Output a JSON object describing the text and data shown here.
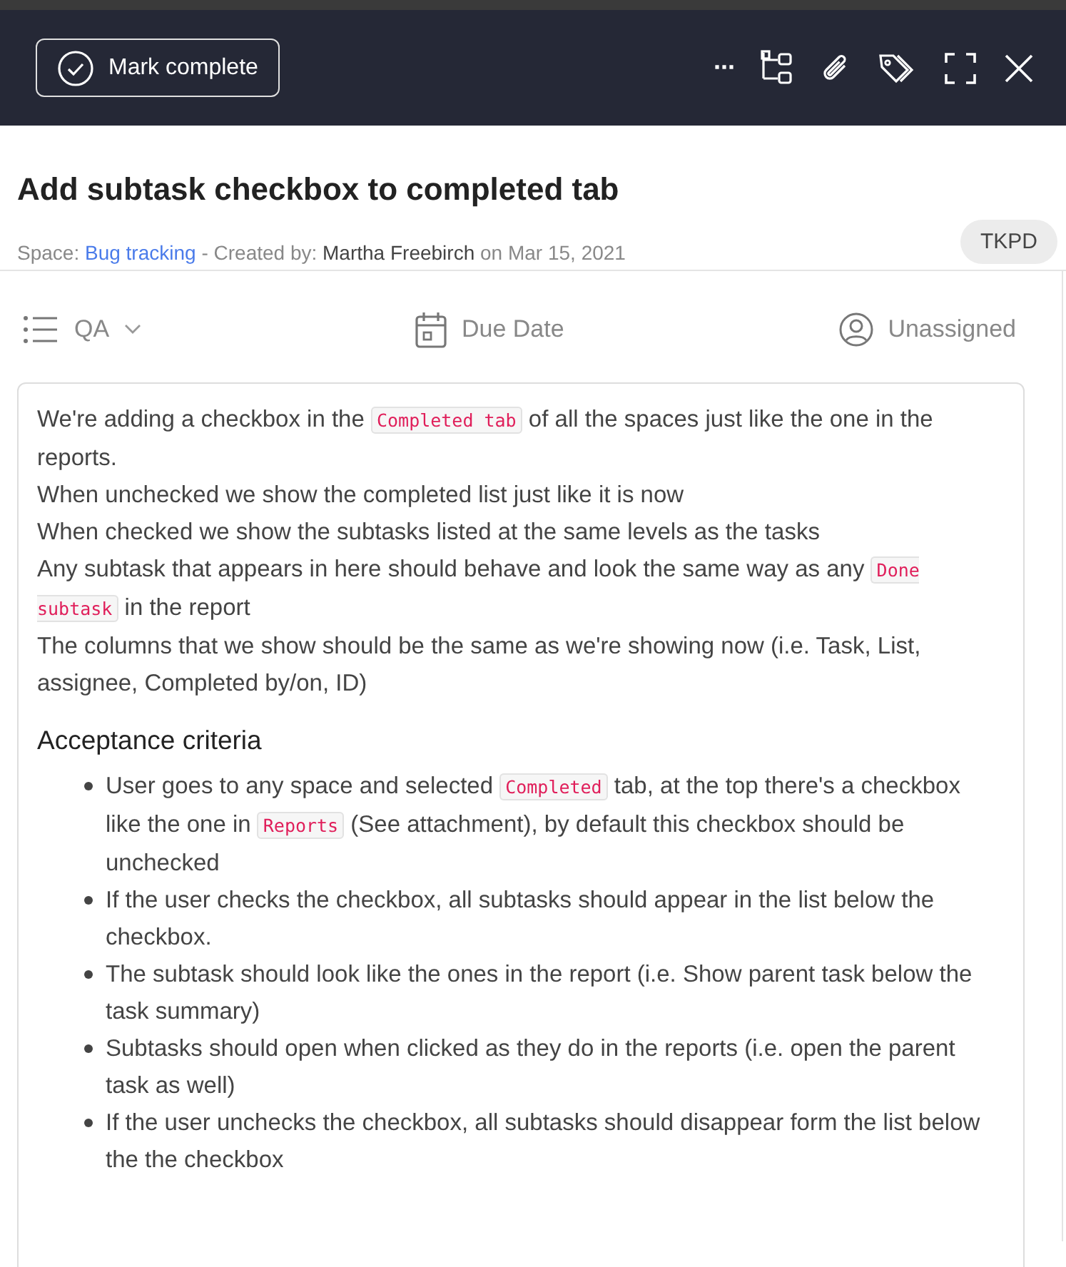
{
  "header": {
    "mark_complete": "Mark complete",
    "more": "···"
  },
  "title": "Add subtask checkbox to completed tab",
  "meta": [
    {
      "kind": "text",
      "text": "Space: "
    },
    {
      "kind": "link",
      "text": "Bug tracking"
    },
    {
      "kind": "text",
      "text": " - Created by: "
    },
    {
      "kind": "strong",
      "text": "Martha Freebirch"
    },
    {
      "kind": "text",
      "text": " on Mar 15, 2021"
    }
  ],
  "tag": "TKPD",
  "toolbar": {
    "list": "QA",
    "due": "Due Date",
    "assignee": "Unassigned"
  },
  "description": [
    [
      {
        "kind": "text",
        "text": "We're adding a checkbox in the "
      },
      {
        "kind": "code",
        "text": "Completed tab"
      },
      {
        "kind": "text",
        "text": " of all the spaces just like the one in the reports."
      }
    ],
    [
      {
        "kind": "text",
        "text": "When unchecked we show the completed list just like it is now"
      }
    ],
    [
      {
        "kind": "text",
        "text": "When checked we show the subtasks listed at the same levels as the tasks"
      }
    ],
    [
      {
        "kind": "text",
        "text": "Any subtask that appears in here should behave and look the same way as any "
      },
      {
        "kind": "code",
        "text": "Done subtask"
      },
      {
        "kind": "text",
        "text": " in the report"
      }
    ],
    [
      {
        "kind": "text",
        "text": "The columns that we show should be the same as we're showing now (i.e. Task, List, assignee, Completed by/on, ID)"
      }
    ]
  ],
  "criteria_heading": "Acceptance criteria",
  "criteria": [
    [
      {
        "kind": "text",
        "text": "User goes to any space and selected "
      },
      {
        "kind": "code",
        "text": "Completed"
      },
      {
        "kind": "text",
        "text": " tab, at the top there's a checkbox like the one in "
      },
      {
        "kind": "code",
        "text": "Reports"
      },
      {
        "kind": "text",
        "text": " (See attachment), by default this checkbox should be unchecked"
      }
    ],
    [
      {
        "kind": "text",
        "text": "If the user checks the checkbox, all subtasks should appear in the list below the checkbox."
      }
    ],
    [
      {
        "kind": "text",
        "text": "The subtask should look like the ones in the report (i.e. Show parent task below the task summary)"
      }
    ],
    [
      {
        "kind": "text",
        "text": "Subtasks should open when clicked as they do in the reports (i.e. open the parent task as well)"
      }
    ],
    [
      {
        "kind": "text",
        "text": "If the user unchecks the checkbox, all subtasks should disappear form the list below the the checkbox"
      }
    ]
  ]
}
